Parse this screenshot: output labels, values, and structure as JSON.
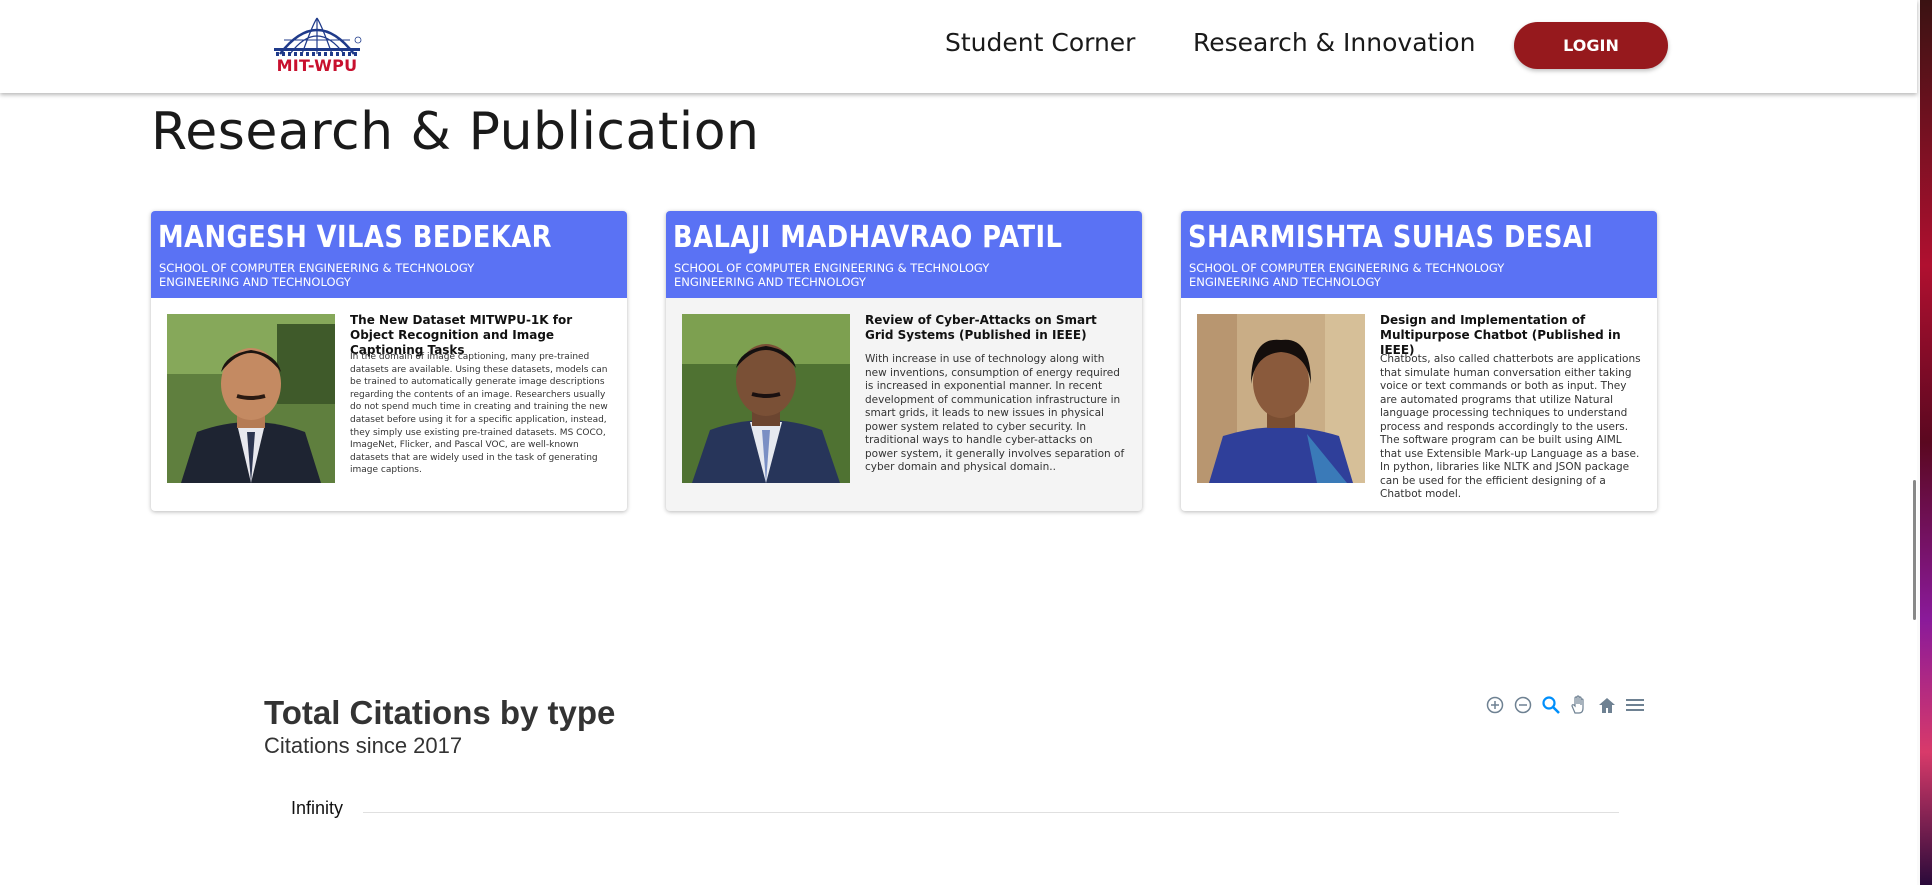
{
  "header": {
    "logo_text": "MIT-WPU",
    "nav": [
      {
        "label": "Student Corner"
      },
      {
        "label": "Research & Innovation"
      }
    ],
    "login_label": "LOGIN"
  },
  "section": {
    "title": "Research & Publication"
  },
  "cards": [
    {
      "name": "MANGESH VILAS BEDEKAR",
      "dept_line1": "SCHOOL OF COMPUTER ENGINEERING & TECHNOLOGY",
      "dept_line2": "ENGINEERING AND TECHNOLOGY",
      "pub_title": "The New Dataset MITWPU-1K for Object Recognition and Image Captioning Tasks",
      "abstract": "In the domain of image captioning, many pre-trained datasets are available. Using these datasets, models can be trained to automatically generate image descriptions regarding the contents of an image. Researchers usually do not spend much time in creating and training the new dataset before using it for a specific application, instead, they simply use existing pre-trained datasets. MS COCO, ImageNet, Flicker, and Pascal VOC, are well-known datasets that are widely used in the task of generating image captions."
    },
    {
      "name": "BALAJI MADHAVRAO PATIL",
      "dept_line1": "SCHOOL OF COMPUTER ENGINEERING & TECHNOLOGY",
      "dept_line2": "ENGINEERING AND TECHNOLOGY",
      "pub_title": "Review of Cyber-Attacks on Smart Grid Systems (Published in IEEE)",
      "abstract": "With increase in use of technology along with new inventions, consumption of energy required is increased in exponential manner. In recent development of communication infrastructure in smart grids, it leads to new issues in physical power system related to cyber security. In traditional ways to handle cyber-attacks on power system, it generally involves separation of cyber domain and physical domain.."
    },
    {
      "name": "SHARMISHTA SUHAS DESAI",
      "dept_line1": "SCHOOL OF COMPUTER ENGINEERING & TECHNOLOGY",
      "dept_line2": "ENGINEERING AND TECHNOLOGY",
      "pub_title": "Design and Implementation of Multipurpose Chatbot (Published in IEEE)",
      "abstract": "Chatbots, also called chatterbots are applications that simulate human conversation either taking voice or text commands or both as input. They are automated programs that utilize Natural language processing techniques to understand process and responds accordingly to the users. The software program can be built using AIML that use Extensible Mark-up Language as a base. In python, libraries like NLTK and JSON package can be used for the efficient designing of a Chatbot model."
    }
  ],
  "chart": {
    "title": "Total Citations by type",
    "subtitle": "Citations since 2017",
    "y_tick": "Infinity",
    "toolbar": [
      "zoom-in-icon",
      "zoom-out-icon",
      "search-zoom-icon",
      "pan-hand-icon",
      "home-icon",
      "menu-icon"
    ]
  },
  "colors": {
    "card_header": "#5a72f4",
    "login_bg": "#96191d",
    "logo_red": "#c8102e",
    "logo_blue": "#1f3a8a"
  }
}
